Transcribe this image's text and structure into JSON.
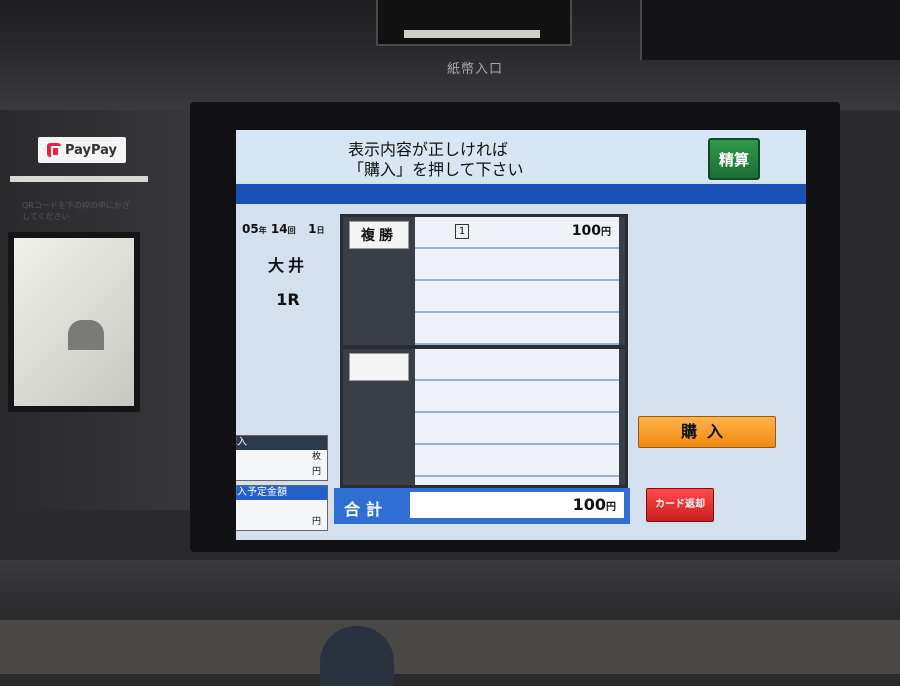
{
  "machine": {
    "bill_slot_label": "紙幣入口",
    "paypay_label": "PayPay",
    "qr_note": "QRコードを下の枠の中にかざしてください"
  },
  "screen": {
    "message_line1": "表示内容が正しければ",
    "message_line2": "「購入」を押して下さい",
    "seisan_label": "精算",
    "race": {
      "date_month": "05",
      "date_month_unit": "年",
      "date_kai": "14",
      "date_kai_unit": "回",
      "date_day": "1",
      "date_day_unit": "日",
      "venue": "大井",
      "race_no": "1R"
    },
    "bets": [
      {
        "type": "複勝",
        "lines": [
          {
            "horse": "1",
            "amount": "100",
            "unit": "円"
          },
          {
            "horse": "",
            "amount": "",
            "unit": ""
          },
          {
            "horse": "",
            "amount": "",
            "unit": ""
          },
          {
            "horse": "",
            "amount": "",
            "unit": ""
          }
        ]
      },
      {
        "type": "",
        "lines": [
          {
            "horse": "",
            "amount": "",
            "unit": ""
          },
          {
            "horse": "",
            "amount": "",
            "unit": ""
          },
          {
            "horse": "",
            "amount": "",
            "unit": ""
          },
          {
            "horse": "",
            "amount": "",
            "unit": ""
          }
        ]
      }
    ],
    "purchase_box": {
      "header": "購入",
      "count_unit": "枚",
      "yen_unit": "円"
    },
    "planned_box": {
      "header": "購入予定金額",
      "yen_unit": "円"
    },
    "total": {
      "label": "合計",
      "value": "100",
      "unit": "円"
    },
    "buy_label": "購入",
    "card_return_label": "カード返却"
  },
  "colors": {
    "header_blue": "#1a4fb3",
    "total_blue": "#2f6fd3",
    "buy_orange": "#f08a12",
    "card_red": "#c81e1e",
    "seisan_green": "#1c6d33"
  }
}
